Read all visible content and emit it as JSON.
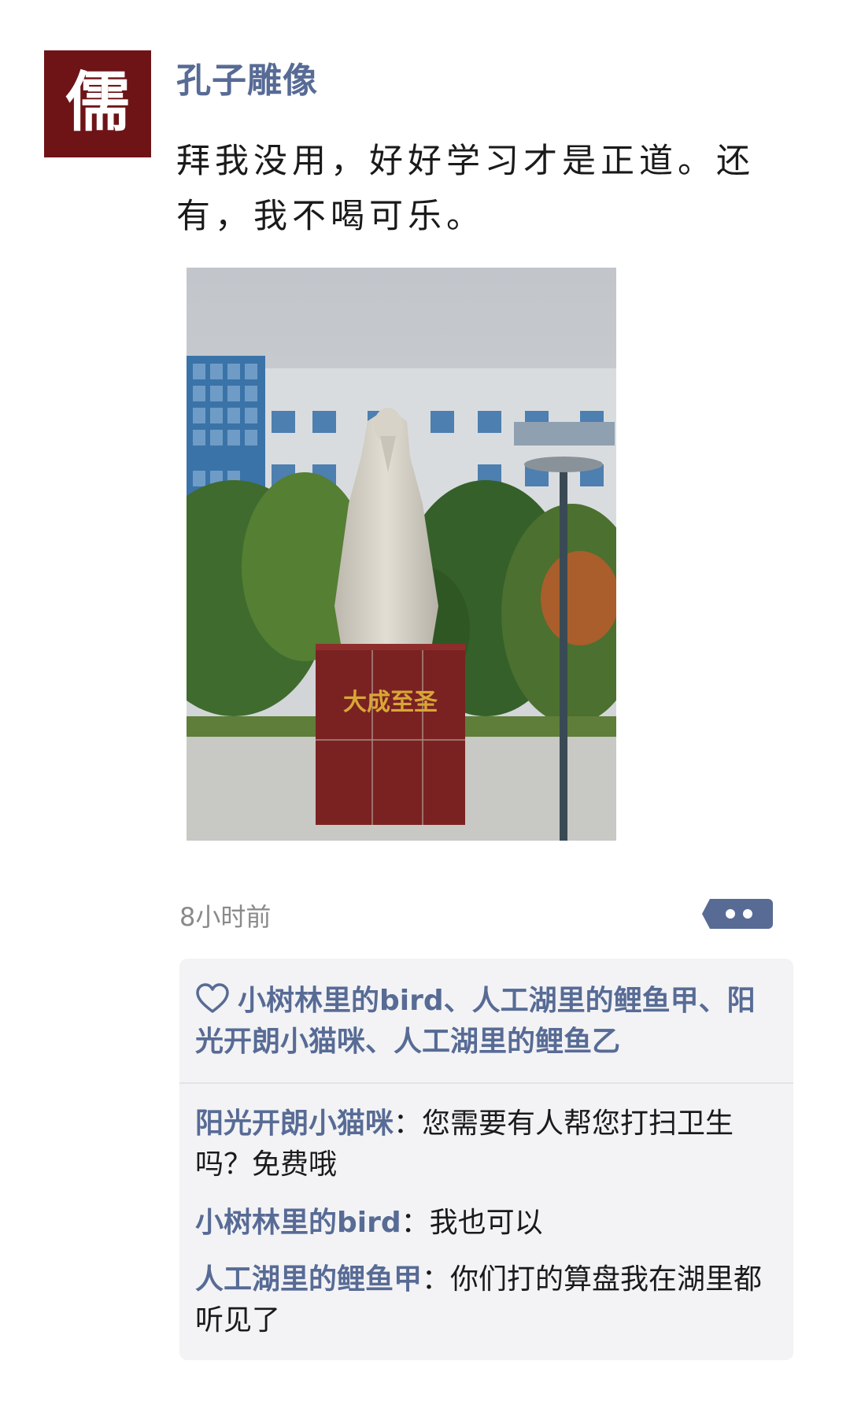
{
  "post": {
    "avatar_char": "儒",
    "username": "孔子雕像",
    "text": "拜我没用，好好学习才是正道。还有，我不喝可乐。",
    "photo": {
      "plaque_text": "大成至圣"
    },
    "timestamp": "8小时前"
  },
  "likes": {
    "names": "小树林里的bird、人工湖里的鲤鱼甲、阳光开朗小猫咪、人工湖里的鲤鱼乙"
  },
  "comments": [
    {
      "author": "阳光开朗小猫咪",
      "separator": "：",
      "text": "您需要有人帮您打扫卫生吗？免费哦"
    },
    {
      "author": "小树林里的bird",
      "separator": "：",
      "text": "我也可以"
    },
    {
      "author": "人工湖里的鲤鱼甲",
      "separator": "：",
      "text": "你们打的算盘我在湖里都听见了"
    }
  ],
  "icons": {
    "more": "more-dots-icon",
    "like": "heart-outline-icon"
  },
  "colors": {
    "name_link": "#576b95",
    "avatar_bg": "#6e1416",
    "comment_bg": "#f3f3f5"
  }
}
